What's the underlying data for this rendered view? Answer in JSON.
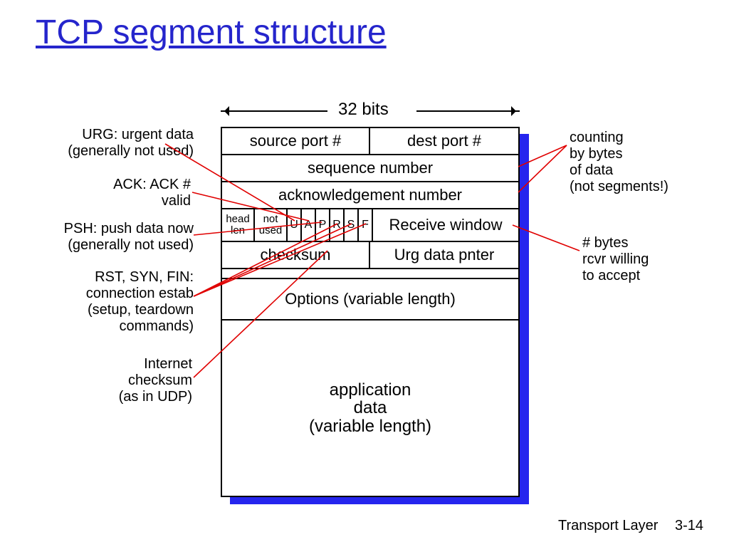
{
  "title": "TCP segment structure",
  "bits_label": "32 bits",
  "frame": {
    "row1": {
      "src": "source port #",
      "dst": "dest port #"
    },
    "row2": "sequence number",
    "row3": "acknowledgement number",
    "row4": {
      "hlen": "head len",
      "unused": "not used",
      "flags": [
        "U",
        "A",
        "P",
        "R",
        "S",
        "F"
      ],
      "rcvwin": "Receive window"
    },
    "row5": {
      "chk": "checksum",
      "urgp": "Urg data pnter"
    },
    "row6": "Options (variable length)",
    "row7": "application\ndata\n(variable length)"
  },
  "annotations": {
    "urg": "URG: urgent data\n(generally not used)",
    "ack": "ACK: ACK #\nvalid",
    "psh": "PSH: push data now\n(generally not used)",
    "rsf": "RST, SYN, FIN:\nconnection estab\n(setup, teardown\ncommands)",
    "chk": "Internet\nchecksum\n(as in UDP)",
    "cnt": "counting\nby bytes\nof data\n(not segments!)",
    "rcv": "# bytes\nrcvr willing\nto accept"
  },
  "footer": {
    "chapter": "Transport Layer",
    "page": "3-14"
  }
}
